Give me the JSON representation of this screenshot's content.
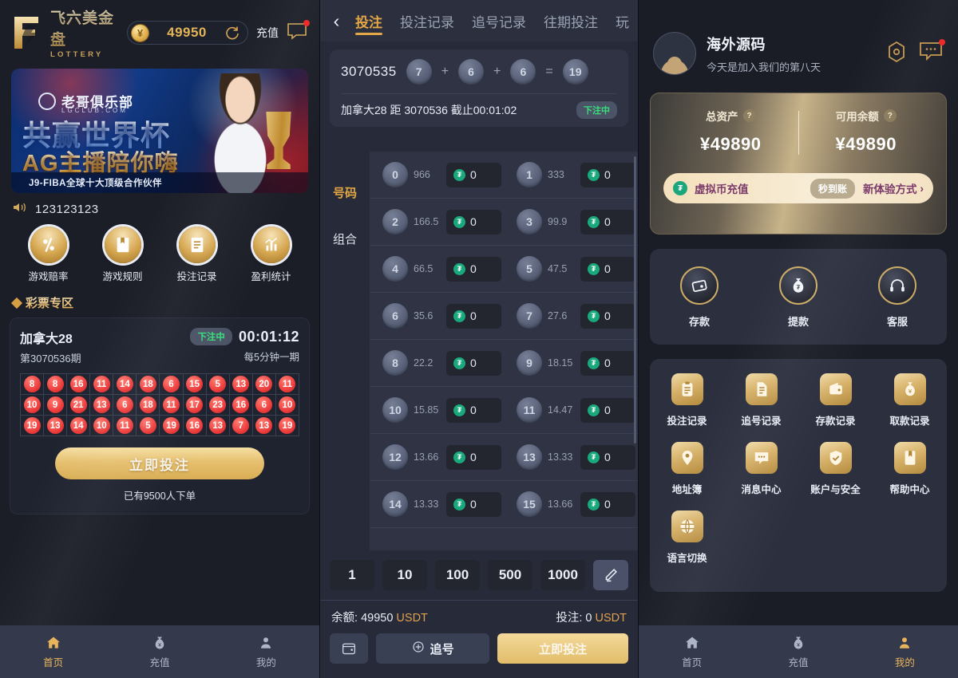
{
  "left": {
    "brand": {
      "cn": "飞六美金盘",
      "en": "LOTTERY"
    },
    "balance": {
      "amount": "49950",
      "refresh_icon": "refresh-icon",
      "recharge_label": "充值",
      "message_icon": "message-icon"
    },
    "banner": {
      "club_name": "老哥俱乐部",
      "club_domain": "LGCLUB.COM",
      "headline": "共赢世界杯",
      "subline": "AG主播陪你嗨",
      "footer": "J9-FIBA全球十大顶级合作伙伴"
    },
    "marquee": {
      "icon": "speaker-icon",
      "text": "123123123"
    },
    "quick_menu": [
      {
        "label": "游戏赔率",
        "icon": "percent-icon"
      },
      {
        "label": "游戏规则",
        "icon": "book-icon"
      },
      {
        "label": "投注记录",
        "icon": "document-icon"
      },
      {
        "label": "盈利统计",
        "icon": "chart-icon"
      }
    ],
    "section_title": "彩票专区",
    "lottery_card": {
      "name": "加拿大28",
      "issue": "第3070536期",
      "status": "下注中",
      "timer": "00:01:12",
      "frequency": "每5分钟一期",
      "history_rows": [
        [
          "8",
          "8",
          "16",
          "11",
          "14",
          "18",
          "6",
          "15",
          "5",
          "13",
          "20",
          "11"
        ],
        [
          "10",
          "9",
          "21",
          "13",
          "6",
          "18",
          "11",
          "17",
          "23",
          "16",
          "6",
          "10"
        ],
        [
          "19",
          "13",
          "14",
          "10",
          "11",
          "5",
          "19",
          "16",
          "13",
          "7",
          "13",
          "19"
        ]
      ],
      "bet_button": "立即投注",
      "order_count": "已有9500人下单"
    },
    "tabbar": [
      {
        "label": "首页",
        "icon": "home-icon",
        "active": true
      },
      {
        "label": "充值",
        "icon": "money-bag-icon",
        "active": false
      },
      {
        "label": "我的",
        "icon": "user-icon",
        "active": false
      }
    ]
  },
  "middle": {
    "back_icon": "chevron-left-icon",
    "tabs": [
      {
        "label": "投注",
        "active": true
      },
      {
        "label": "投注记录",
        "active": false
      },
      {
        "label": "追号记录",
        "active": false
      },
      {
        "label": "往期投注",
        "active": false
      },
      {
        "label": "玩",
        "active": false
      }
    ],
    "result": {
      "issue": "3070535",
      "balls": [
        "7",
        "6",
        "6"
      ],
      "sum": "19",
      "plus": "+",
      "equals": "="
    },
    "countdown_text": "加拿大28 距 3070536 截止00:01:02",
    "status": "下注中",
    "side_tabs": [
      {
        "label": "号码",
        "active": true
      },
      {
        "label": "组合",
        "active": false
      }
    ],
    "bet_options": [
      {
        "number": "0",
        "odds": "966",
        "amount": "0"
      },
      {
        "number": "1",
        "odds": "333",
        "amount": "0"
      },
      {
        "number": "2",
        "odds": "166.5",
        "amount": "0"
      },
      {
        "number": "3",
        "odds": "99.9",
        "amount": "0"
      },
      {
        "number": "4",
        "odds": "66.5",
        "amount": "0"
      },
      {
        "number": "5",
        "odds": "47.5",
        "amount": "0"
      },
      {
        "number": "6",
        "odds": "35.6",
        "amount": "0"
      },
      {
        "number": "7",
        "odds": "27.6",
        "amount": "0"
      },
      {
        "number": "8",
        "odds": "22.2",
        "amount": "0"
      },
      {
        "number": "9",
        "odds": "18.15",
        "amount": "0"
      },
      {
        "number": "10",
        "odds": "15.85",
        "amount": "0"
      },
      {
        "number": "11",
        "odds": "14.47",
        "amount": "0"
      },
      {
        "number": "12",
        "odds": "13.66",
        "amount": "0"
      },
      {
        "number": "13",
        "odds": "13.33",
        "amount": "0"
      },
      {
        "number": "14",
        "odds": "13.33",
        "amount": "0"
      },
      {
        "number": "15",
        "odds": "13.66",
        "amount": "0"
      }
    ],
    "chips": [
      "1",
      "10",
      "100",
      "500",
      "1000"
    ],
    "chip_custom_icon": "pencil-icon",
    "balance_label": "余额:",
    "balance_value": "49950",
    "balance_unit": "USDT",
    "bet_label": "投注:",
    "bet_value": "0",
    "bet_unit": "USDT",
    "wallet_icon": "wallet-icon",
    "chase_label": "追号",
    "chase_icon": "plus-circle-icon",
    "submit_label": "立即投注"
  },
  "right": {
    "profile": {
      "avatar_icon": "avatar-icon",
      "name": "海外源码",
      "subtitle": "今天是加入我们的第八天",
      "settings_icon": "gear-hex-icon",
      "message_icon": "message-icon"
    },
    "balance_card": {
      "total_label": "总资产",
      "total_value": "¥49890",
      "available_label": "可用余额",
      "available_value": "¥49890",
      "help_icon": "question-icon",
      "promo": {
        "icon": "usdt-icon",
        "title": "虚拟币充值",
        "pill": "秒到账",
        "more": "新体验方式",
        "chevron": "chevron-right-icon"
      }
    },
    "actions": [
      {
        "label": "存款",
        "icon": "deposit-icon"
      },
      {
        "label": "提款",
        "icon": "withdraw-icon"
      },
      {
        "label": "客服",
        "icon": "headset-icon"
      }
    ],
    "menu": [
      {
        "label": "投注记录",
        "icon": "clipboard-icon"
      },
      {
        "label": "追号记录",
        "icon": "document-icon"
      },
      {
        "label": "存款记录",
        "icon": "wallet-icon"
      },
      {
        "label": "取款记录",
        "icon": "money-bag-icon"
      },
      {
        "label": "地址簿",
        "icon": "location-pin-icon"
      },
      {
        "label": "消息中心",
        "icon": "chat-icon"
      },
      {
        "label": "账户与安全",
        "icon": "shield-check-icon"
      },
      {
        "label": "帮助中心",
        "icon": "book-icon"
      },
      {
        "label": "语言切换",
        "icon": "globe-icon"
      }
    ],
    "tabbar": [
      {
        "label": "首页",
        "icon": "home-icon",
        "active": false
      },
      {
        "label": "充值",
        "icon": "money-bag-icon",
        "active": false
      },
      {
        "label": "我的",
        "icon": "user-icon",
        "active": true
      }
    ]
  },
  "colors": {
    "gold": "#e0a14e",
    "gold_light": "#f3d99a",
    "green": "#39e07a",
    "red_ball": "#ed3c3c",
    "panel_bg": "#1b1e27",
    "mid_bg": "#272a38"
  }
}
